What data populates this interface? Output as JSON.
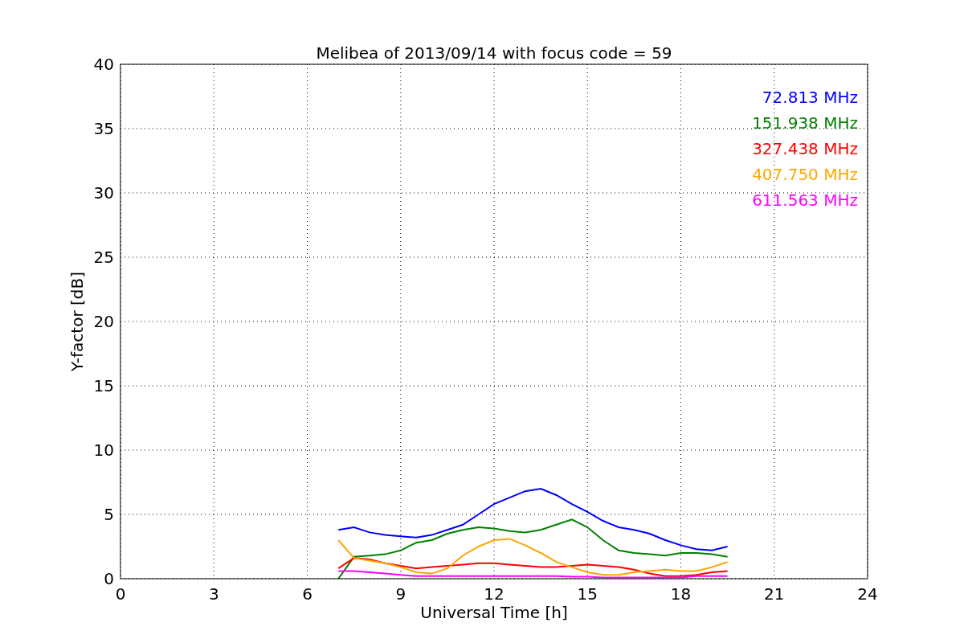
{
  "chart_data": {
    "type": "line",
    "title": "Melibea of 2013/09/14 with focus code = 59",
    "xlabel": "Universal Time [h]",
    "ylabel": "Y-factor [dB]",
    "x": [
      7.0,
      7.5,
      8.0,
      8.5,
      9.0,
      9.5,
      10.0,
      10.5,
      11.0,
      11.5,
      12.0,
      12.5,
      13.0,
      13.5,
      14.0,
      14.5,
      15.0,
      15.5,
      16.0,
      16.5,
      17.0,
      17.5,
      18.0,
      18.5,
      19.0,
      19.5
    ],
    "series": [
      {
        "name": "72.813 MHz",
        "color": "#0000ff",
        "values": [
          3.8,
          4.0,
          3.6,
          3.4,
          3.3,
          3.2,
          3.4,
          3.8,
          4.2,
          5.0,
          5.8,
          6.3,
          6.8,
          7.0,
          6.5,
          5.8,
          5.2,
          4.5,
          4.0,
          3.8,
          3.5,
          3.0,
          2.6,
          2.3,
          2.2,
          2.5
        ]
      },
      {
        "name": "151.938 MHz",
        "color": "#008000",
        "values": [
          0.0,
          1.7,
          1.8,
          1.9,
          2.2,
          2.8,
          3.0,
          3.5,
          3.8,
          4.0,
          3.9,
          3.7,
          3.6,
          3.8,
          4.2,
          4.6,
          4.0,
          3.0,
          2.2,
          2.0,
          1.9,
          1.8,
          2.0,
          2.0,
          1.9,
          1.7
        ]
      },
      {
        "name": "327.438 MHz",
        "color": "#ff0000",
        "values": [
          0.8,
          1.6,
          1.5,
          1.2,
          1.0,
          0.8,
          0.9,
          1.0,
          1.1,
          1.2,
          1.2,
          1.1,
          1.0,
          0.9,
          0.9,
          1.0,
          1.1,
          1.0,
          0.9,
          0.7,
          0.4,
          0.2,
          0.2,
          0.3,
          0.5,
          0.6
        ]
      },
      {
        "name": "407.750 MHz",
        "color": "#ffa500",
        "values": [
          3.0,
          1.6,
          1.4,
          1.2,
          0.9,
          0.5,
          0.4,
          0.8,
          1.8,
          2.5,
          3.0,
          3.1,
          2.6,
          2.0,
          1.3,
          0.9,
          0.5,
          0.3,
          0.3,
          0.5,
          0.6,
          0.7,
          0.6,
          0.6,
          0.9,
          1.3
        ]
      },
      {
        "name": "611.563 MHz",
        "color": "#ff00ff",
        "values": [
          0.6,
          0.6,
          0.5,
          0.4,
          0.3,
          0.2,
          0.2,
          0.2,
          0.2,
          0.2,
          0.2,
          0.2,
          0.2,
          0.2,
          0.2,
          0.15,
          0.15,
          0.1,
          0.1,
          0.1,
          0.1,
          0.1,
          0.1,
          0.2,
          0.2,
          0.2
        ]
      }
    ],
    "grid": true,
    "xlim": [
      0,
      24
    ],
    "ylim": [
      0,
      40
    ],
    "xticks": [
      0,
      3,
      6,
      9,
      12,
      15,
      18,
      21,
      24
    ],
    "yticks": [
      0,
      5,
      10,
      15,
      20,
      25,
      30,
      35,
      40
    ]
  }
}
